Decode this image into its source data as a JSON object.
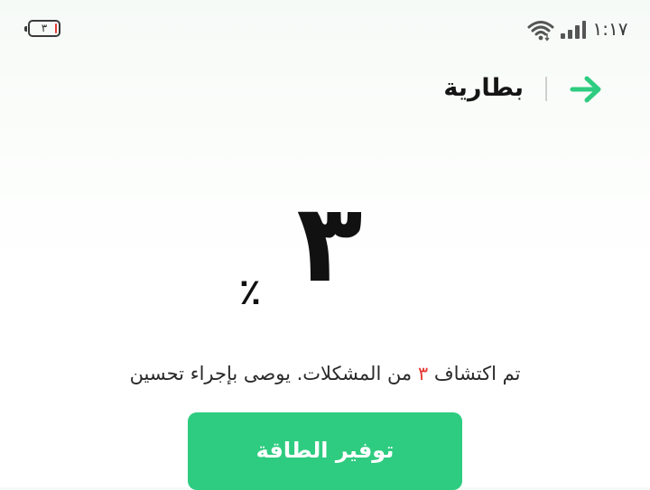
{
  "status_bar": {
    "battery_level": "٣",
    "battery_fill_fraction": 0.03,
    "clock": "١:١٧",
    "wifi_icon": "wifi-icon",
    "signal_icon": "cellular-signal-icon"
  },
  "header": {
    "title": "بطارية",
    "back_icon": "arrow-right-icon"
  },
  "battery_percent": {
    "value": "٣",
    "sign": "٪"
  },
  "description": {
    "prefix": "تم اكتشاف",
    "count": "٣",
    "suffix": "من المشكلات. يوصى بإجراء تحسين"
  },
  "action": {
    "label": "توفير الطاقة"
  },
  "colors": {
    "accent_green": "#2ecc80",
    "alert_red": "#e53935",
    "text_dark": "#111111"
  }
}
